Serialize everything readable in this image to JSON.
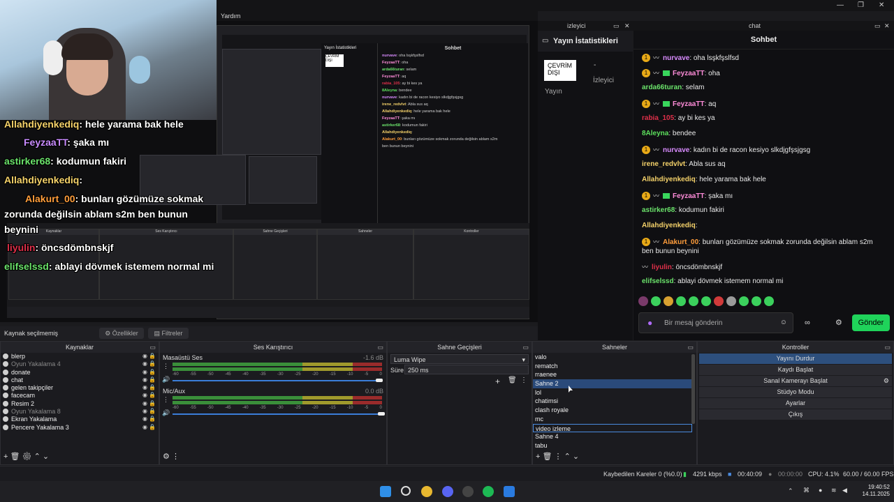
{
  "menu": {
    "help": "Yardım"
  },
  "overlay_chat": [
    {
      "name": "Allahdiyenkediq",
      "text": ": hele yarama bak hele"
    },
    {
      "name": "FeyzaaTT",
      "text": ": şaka mı"
    },
    {
      "name": "astirker68",
      "text": ": kodumun fakiri"
    },
    {
      "name": "Allahdiyenkediq",
      "text": ":"
    },
    {
      "name": "Alakurt_00",
      "text": ": bunları gözümüze sokmak"
    },
    {
      "name": "",
      "text": "zorunda değilsin ablam s2m ben bunun"
    },
    {
      "name": "",
      "text": "beynini"
    },
    {
      "name": "liyulin",
      "text": ": öncsdömbnskjf"
    },
    {
      "name": "elifselssd",
      "text": ": ablayi dövmek istemem normal mi"
    }
  ],
  "dock_titles": {
    "stats": "izleyici",
    "chat": "chat"
  },
  "stats": {
    "title": "Yayın İstatistikleri",
    "status": "ÇEVRİM DIŞI",
    "stream": "Yayın",
    "dash": "-",
    "viewers": "İzleyici"
  },
  "chat": {
    "title": "Sohbet",
    "messages": [
      {
        "user": "nurvave",
        "color": "#d98cff",
        "text": ": oha lsşkfşslfsd",
        "badge": true,
        "tilde": true
      },
      {
        "user": "FeyzaaTT",
        "color": "#ff8cd9",
        "text": ": oha",
        "badge": true,
        "tilde": true,
        "sub": true
      },
      {
        "user": "arda66turan",
        "color": "#6be36b",
        "text": ": selam",
        "badge": false
      },
      {
        "user": "FeyzaaTT",
        "color": "#ff8cd9",
        "text": ": aq",
        "badge": true,
        "tilde": true,
        "sub": true
      },
      {
        "user": "rabia_105",
        "color": "#e0304a",
        "text": ": ay bi kes ya"
      },
      {
        "user": "8Aleyna",
        "color": "#5de05d",
        "text": ": bendee"
      },
      {
        "user": "nurvave",
        "color": "#d98cff",
        "text": ": kadın bi de racon kesiyo slkdjgfşsjgsg",
        "badge": true,
        "tilde": true
      },
      {
        "user": "irene_redvlvt",
        "color": "#f5d26a",
        "text": ": Abla sus aq"
      },
      {
        "user": "Allahdiyenkediq",
        "color": "#f5d26a",
        "text": ": hele yarama bak hele"
      },
      {
        "user": "FeyzaaTT",
        "color": "#ff8cd9",
        "text": ": şaka mı",
        "badge": true,
        "tilde": true,
        "sub": true
      },
      {
        "user": "astirker68",
        "color": "#6be36b",
        "text": ": kodumun fakiri"
      },
      {
        "user": "Allahdiyenkediq",
        "color": "#f5d26a",
        "text": ":"
      },
      {
        "user": "Alakurt_00",
        "color": "#ff9d3b",
        "text": ": bunları gözümüze sokmak zorunda değilsin ablam s2m",
        "badge": true,
        "tilde": true
      },
      {
        "user": "",
        "color": "#eaeaea",
        "text": "ben bunun beynini"
      },
      {
        "user": "liyulin",
        "color": "#e0304a",
        "text": ": öncsdömbnskjf",
        "tilde": true
      },
      {
        "user": "elifselssd",
        "color": "#6be36b",
        "text": ": ablayi dövmek istemem normal mi"
      }
    ],
    "input_placeholder": "Bir mesaj gönderin",
    "send": "Gönder"
  },
  "source_bar": {
    "label": "Kaynak seçilmemiş",
    "properties": "Özellikler",
    "filters": "Filtreler"
  },
  "sources": {
    "title": "Kaynaklar",
    "items": [
      {
        "name": "blerp",
        "dim": false
      },
      {
        "name": "Oyun Yakalama 4",
        "dim": true
      },
      {
        "name": "donate",
        "dim": false
      },
      {
        "name": "chat",
        "dim": false
      },
      {
        "name": "gelen takipçiler",
        "dim": false
      },
      {
        "name": "facecam",
        "dim": false
      },
      {
        "name": "Resim 2",
        "dim": false
      },
      {
        "name": "Oyun Yakalama 8",
        "dim": true
      },
      {
        "name": "Ekran Yakalama",
        "dim": false
      },
      {
        "name": "Pencere Yakalama 3",
        "dim": false
      }
    ]
  },
  "mixer": {
    "title": "Ses Karıştırıcı",
    "channels": [
      {
        "name": "Masaüstü Ses",
        "db": "-1.6 dB",
        "level": 0.99
      },
      {
        "name": "Mic/Aux",
        "db": "0.0 dB",
        "level": 1.0
      }
    ],
    "ticks": [
      "-60",
      "-55",
      "-50",
      "-45",
      "-40",
      "-35",
      "-30",
      "-25",
      "-20",
      "-15",
      "-10",
      "-5",
      "0"
    ]
  },
  "transitions": {
    "title": "Sahne Geçişleri",
    "selected": "Luma Wipe",
    "duration_label": "Süre",
    "duration": "250 ms"
  },
  "scenes": {
    "title": "Sahneler",
    "items": [
      "valo",
      "rematch",
      "rraenee",
      "Sahne 2",
      "lol",
      "chatimsi",
      "clash royale",
      "mc",
      "video izleme",
      "Sahne 4",
      "tabu"
    ],
    "selected": "Sahne 2",
    "focused": "video izleme"
  },
  "controls": {
    "title": "Kontroller",
    "buttons": [
      "Yayını Durdur",
      "Kaydı Başlat",
      "Sanal Kamerayı Başlat",
      "Stüdyo Modu",
      "Ayarlar",
      "Çıkış"
    ]
  },
  "statusbar": {
    "dropped": "Kaybedilen Kareler 0 (%0.0)",
    "bitrate": "4291 kbps",
    "live_time": "00:40:09",
    "rec_time": "00:00:00",
    "cpu": "CPU: 4.1%",
    "fps": "60.00 / 60.00 FPS"
  },
  "taskbar": {
    "time": "19:40:52",
    "date": "14.11.2025"
  }
}
